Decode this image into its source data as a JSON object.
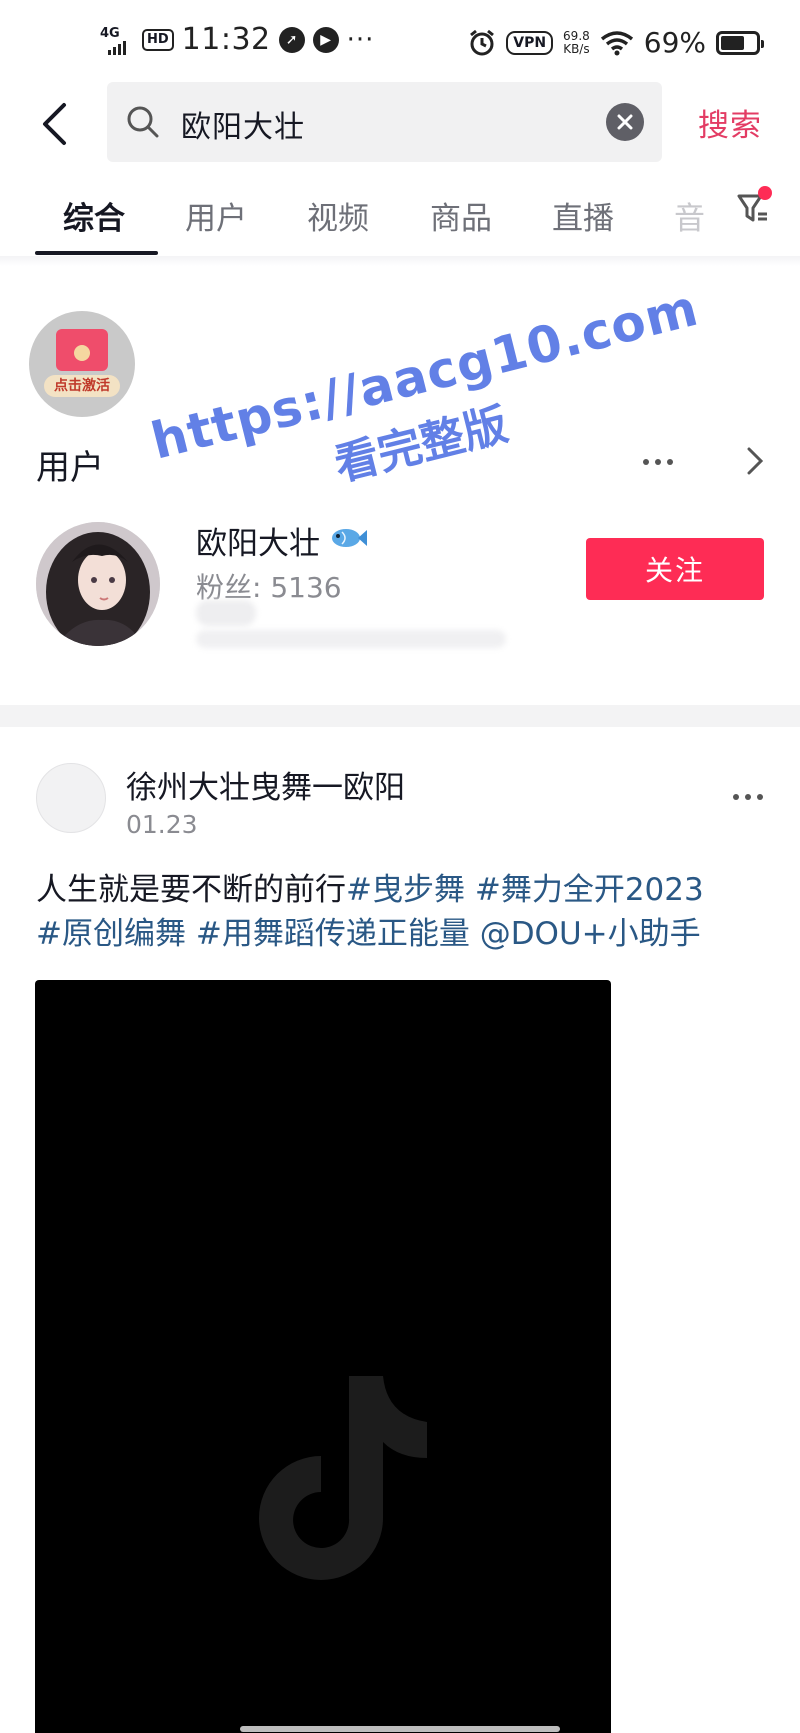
{
  "status_bar": {
    "network": "4G",
    "hd": "HD",
    "time": "11:32",
    "dots": "···",
    "vpn": "VPN",
    "speed_value": "69.8",
    "speed_unit": "KB/s",
    "battery_pct": "69%",
    "battery_level": 0.69
  },
  "search": {
    "query": "欧阳大壮",
    "submit_label": "搜索"
  },
  "tabs": [
    {
      "label": "综合",
      "active": true
    },
    {
      "label": "用户"
    },
    {
      "label": "视频"
    },
    {
      "label": "商品"
    },
    {
      "label": "直播"
    },
    {
      "label": "音"
    }
  ],
  "red_packet": {
    "label": "点击激活"
  },
  "user_section": {
    "title": "用户",
    "user": {
      "name": "欧阳大壮",
      "fans": "粉丝: 5136",
      "follow_label": "关注"
    }
  },
  "post": {
    "author": "徐州大壮曳舞一欧阳",
    "date": "01.23",
    "caption_text": "人生就是要不断的前行",
    "hashtags": [
      "#曳步舞",
      "#舞力全开2023",
      "#原创编舞",
      "#用舞蹈传递正能量",
      "@DOU+小助手"
    ]
  },
  "watermark": {
    "line1": "https://aacg10.com",
    "line2": "看完整版"
  },
  "colors": {
    "accent": "#fe2c55",
    "search_text": "#e33c64",
    "hashtag": "#2a5885",
    "watermark": "#3b61e0"
  }
}
